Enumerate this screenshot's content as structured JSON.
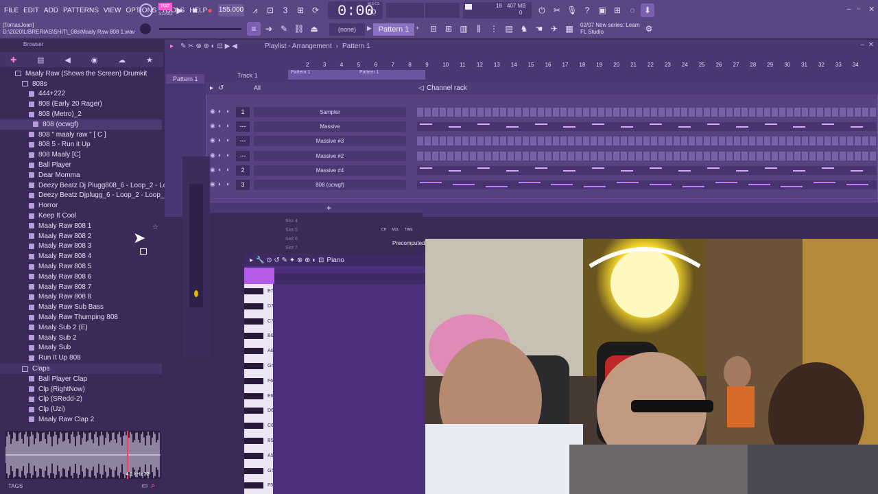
{
  "menu": [
    "FILE",
    "EDIT",
    "ADD",
    "PATTERNS",
    "VIEW",
    "OPTIONS",
    "TOOLS",
    "HELP"
  ],
  "transport": {
    "pat_label": "PAT",
    "song_label": "SONG",
    "tempo": "155.000",
    "time": "0:00",
    "time_sub": "00",
    "time_unit": "M:S:CS"
  },
  "cpu": {
    "voices": "18",
    "memory": "407 MB",
    "zero": "0"
  },
  "hint": {
    "counter": "02/07",
    "line1": "New series: Learn",
    "line2": "FL Studio"
  },
  "file": {
    "user": "[TomasJoan]",
    "path": "D:\\2020\\LIBRERIAS\\SHIT\\_08s\\Maaly Raw 808 1.wav"
  },
  "pattern": {
    "selector": "(none)",
    "name": "Pattern 1"
  },
  "browser": {
    "title": "Browser",
    "root": "Maaly Raw (Shows the Screen) Drumkit",
    "folder_808": "808s",
    "items_808": [
      "444+222",
      "808 (Early 20 Rager)",
      "808 (Metro)_2",
      "808 (ocwgf)",
      "808 \" maaly raw \" [ C ]",
      "808 5 - Run it Up",
      "808 Maaly [C]",
      "Ball Player",
      "Dear Momma",
      "Deezy Beatz Dj Plugg808_6 - Loop_2 - Loop_2",
      "Deezy Beatz Djplugg_6 - Loop_2 - Loop_2",
      "Horror",
      "Keep It Cool",
      "Maaly Raw 808 1",
      "Maaly Raw 808 2",
      "Maaly Raw 808 3",
      "Maaly Raw 808 4",
      "Maaly Raw 808 5",
      "Maaly Raw 808 6",
      "Maaly Raw 808 7",
      "Maaly Raw 808 8",
      "Maaly Raw Sub Bass",
      "Maaly Raw Thumping 808",
      "Maaly Sub 2 (E)",
      "Maaly Sub 2",
      "Maaly Sub",
      "Run It Up 808"
    ],
    "folder_claps": "Claps",
    "items_claps": [
      "Ball Player Clap",
      "Clp (RightNow)",
      "Clp (SRedd-2)",
      "Clp (Uzi)",
      "Maaly Raw Clap 2"
    ],
    "wave_info": "4.1 kHz 32",
    "tags": "TAGS"
  },
  "playlist": {
    "title": "Playlist - Arrangement",
    "pattern": "Pattern 1",
    "track": "Track 1",
    "left_pattern": "Pattern 1",
    "ruler": [
      "2",
      "3",
      "4",
      "5",
      "6",
      "7",
      "8",
      "9",
      "10",
      "11",
      "12",
      "13",
      "14",
      "15",
      "16",
      "17",
      "18",
      "19",
      "20",
      "21",
      "22",
      "23",
      "24",
      "25",
      "26",
      "27",
      "28",
      "29",
      "30",
      "31",
      "32",
      "33",
      "34"
    ]
  },
  "channel_rack": {
    "title": "Channel rack",
    "filter": "All",
    "channels": [
      {
        "num": "1",
        "name": "Sampler",
        "kind": "steps"
      },
      {
        "num": "---",
        "name": "Massive",
        "kind": "notes"
      },
      {
        "num": "---",
        "name": "Massive #3",
        "kind": "steps"
      },
      {
        "num": "---",
        "name": "Massive #2",
        "kind": "steps"
      },
      {
        "num": "2",
        "name": "Massive #4",
        "kind": "notes"
      },
      {
        "num": "3",
        "name": "808 (ocwgf)",
        "kind": "notes808"
      }
    ],
    "add": "+"
  },
  "mixer": {
    "precomputed": "Precomputed",
    "slots": [
      "Slot 4",
      "Slot 5",
      "Slot 6",
      "Slot 7"
    ],
    "cols": [
      "CH",
      "MUL",
      "TIME"
    ]
  },
  "piano_roll": {
    "title": "Piano",
    "keys": [
      "E7",
      "D7",
      "C7",
      "B6",
      "A6",
      "G6",
      "F6",
      "E6",
      "D6",
      "C6",
      "B5",
      "A5",
      "G5",
      "F5"
    ]
  },
  "colors": {
    "accent": "#ff5ad0",
    "ui_bg": "#5b4684",
    "panel": "#3b2a58"
  }
}
